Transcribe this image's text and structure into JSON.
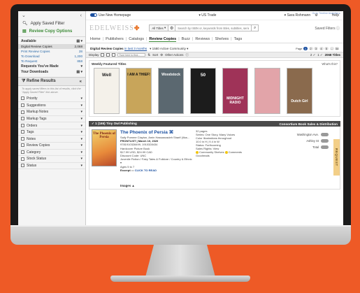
{
  "sidebar": {
    "apply_saved_filter": "Apply Saved Filter",
    "review_copy_options": "Review Copy Options",
    "available_label": "Available",
    "counts": [
      {
        "label": "Digital Review Copies",
        "value": "2,068"
      },
      {
        "label": "Print Review Copies",
        "value": "28"
      },
      {
        "label": "To Download",
        "value": "1,200"
      },
      {
        "label": "To Request",
        "value": "858"
      }
    ],
    "requests_label": "Requests You've Made",
    "downloads_label": "Your Downloads",
    "refine_results": "Refine Results",
    "hint": "To apply saved filters to this list of results, click the \"Apply Saved Filter\" link above.",
    "facets": [
      "Priority",
      "Suggestions",
      "Markup Notes",
      "Markup Tags",
      "Orders",
      "Tags",
      "Notes",
      "Review Copies",
      "Category",
      "Stock Status",
      "Status"
    ]
  },
  "topbar": {
    "use_new_homepage": "Use New Homepage",
    "region": "▾ US Trade",
    "user": "▾ Sara Rohmann",
    "help": "Help",
    "tiny_link": "Go to Treeline Analytics ▸"
  },
  "brand": {
    "logo": "EDELWEISS",
    "search_category": "All Titles",
    "search_placeholder": "Search by ISBN or, keywords from titles, subtitles, series, co...",
    "saved_filters": "Saved Filters"
  },
  "nav": {
    "items": [
      "Home",
      "Publishers",
      "Catalogs",
      "Review Copies",
      "Buzz",
      "Reviews",
      "Shelves",
      "Tags"
    ],
    "active": "Review Copies"
  },
  "subheader": {
    "title": "Digital Review Copies",
    "period": "in last 3 months",
    "community": "▾ 1580 Active Community ▾",
    "page_label": "Page",
    "pages": [
      "1",
      "2",
      "3",
      "4",
      "5",
      "...",
      "34"
    ],
    "current_page": "1"
  },
  "toolbar": {
    "display": "Display",
    "filter_placeholder": "Type here to find...",
    "sort": "Sort",
    "other_actions": "Other Actions",
    "selected": "2 ✓",
    "flags": "1 ✓",
    "total_titles": "2068 Titles"
  },
  "featured": {
    "title": "Weekly Featured Titles",
    "whats_this": "What's this?",
    "covers": [
      {
        "title": "Well",
        "bg": "#f4f1ea",
        "fg": "#222"
      },
      {
        "title": "I AM A THIEF!",
        "bg": "#c8a55a",
        "fg": "#111"
      },
      {
        "title": "Woodstock",
        "bg": "#5b6870",
        "fg": "#fff"
      },
      {
        "title": "50",
        "bg": "#1c1c1c",
        "fg": "#fff"
      },
      {
        "title": "MIDNIGHT RADIO",
        "bg": "#9f3358",
        "fg": "#fff"
      },
      {
        "title": "",
        "bg": "#e2a4a9",
        "fg": "#fff"
      },
      {
        "title": "Dutch Girl",
        "bg": "#8a6a4d",
        "fg": "#fff"
      }
    ]
  },
  "publisher_bar": {
    "left": "✓ 1 (165)  Tiny Owl Publishing",
    "right": "Consortium Book Sales & Distribution"
  },
  "item": {
    "cover_text": "The Phoenix of Persia",
    "title": "The Phoenix of Persia ⌘",
    "authors": "Sally Pomme Clayton, Amin Hassanzadeh Sharif (illus...",
    "frontlist": "FRONTLIST | March 10, 2020",
    "isbns": "9781910328499, 1910328434",
    "format": "Hardcover Picture Book",
    "price": "$17.99 USD, $24.99 CAD",
    "discount": "Discount Code: UNC",
    "category": "Juvenile Fiction / Fairy Tales & Folklore / Country & Ethnic ▾",
    "ages": "Ages 5 to 7",
    "excerpt": "Excerpt",
    "click_to_read": "CLICK TO READ",
    "pages": "32 pages",
    "series": "Series: One Story, Many Voices",
    "illustrations": "Color Illustrations throughout",
    "dimensions": "10.0 in H | 9.4 in W",
    "status": "Status: Forthcoming",
    "sales_rights": "Sales Rights: View",
    "shelves": "Community Shelves",
    "comments": "Comments",
    "goodreads": "Goodreads",
    "stores": [
      "Washington Ave.",
      "Ashley St",
      "Total"
    ],
    "request_tag": "REQUEST",
    "images": "Images ▲"
  }
}
